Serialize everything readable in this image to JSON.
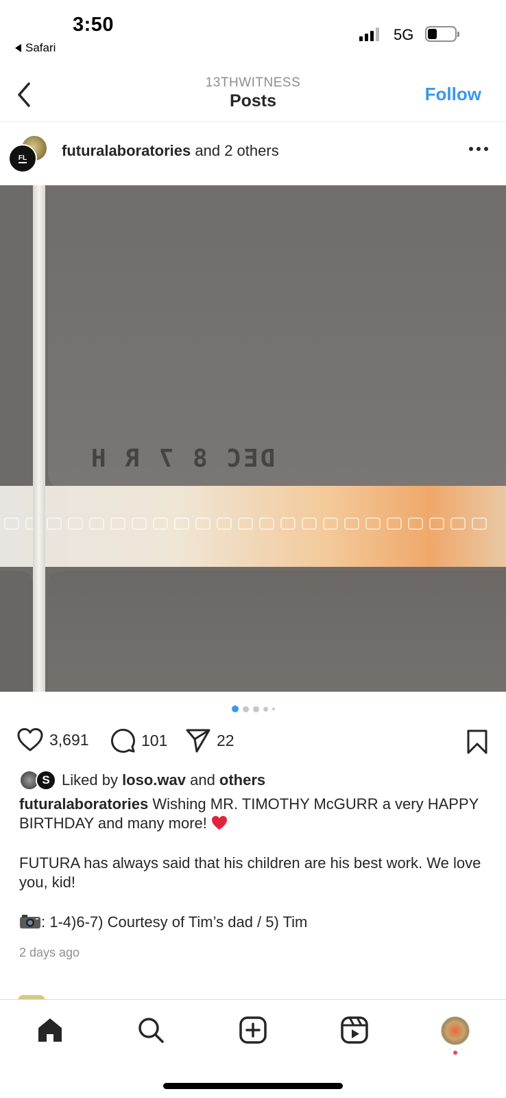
{
  "status_bar": {
    "time": "3:50",
    "back_app": "Safari",
    "network": "5G"
  },
  "header": {
    "subtitle": "13THWITNESS",
    "title": "Posts",
    "follow_label": "Follow"
  },
  "post": {
    "owner_username": "futuralaboratories",
    "owner_suffix": " and 2 others",
    "avatar_text": "FL",
    "photo_stamp": "DEC 8 7 R H",
    "carousel": {
      "count": 5,
      "active_index": 0,
      "active_color": "#3897f0"
    },
    "likes_count": "3,691",
    "comments_count": "101",
    "shares_count": "22",
    "liked_by_prefix": "Liked by ",
    "liked_by_user": "loso.wav",
    "liked_by_and": " and ",
    "liked_by_others": "others",
    "caption_username": "futuralaboratories",
    "caption_line1": " Wishing MR. TIMOTHY McGURR a very HAPPY BIRTHDAY and many more! ",
    "caption_line2": "FUTURA has always said that his children are his best work. We love you, kid!",
    "caption_line3": ": 1-4)6-7) Courtesy of Tim’s dad / 5) Tim",
    "time_ago": "2 days ago"
  },
  "tabbar": {
    "items": [
      "home-icon",
      "search-icon",
      "new-post-icon",
      "reels-icon",
      "profile-avatar"
    ]
  },
  "colors": {
    "accent": "#3897f0",
    "text": "#262626",
    "muted": "#8e8e8e",
    "notification": "#ed4956"
  }
}
